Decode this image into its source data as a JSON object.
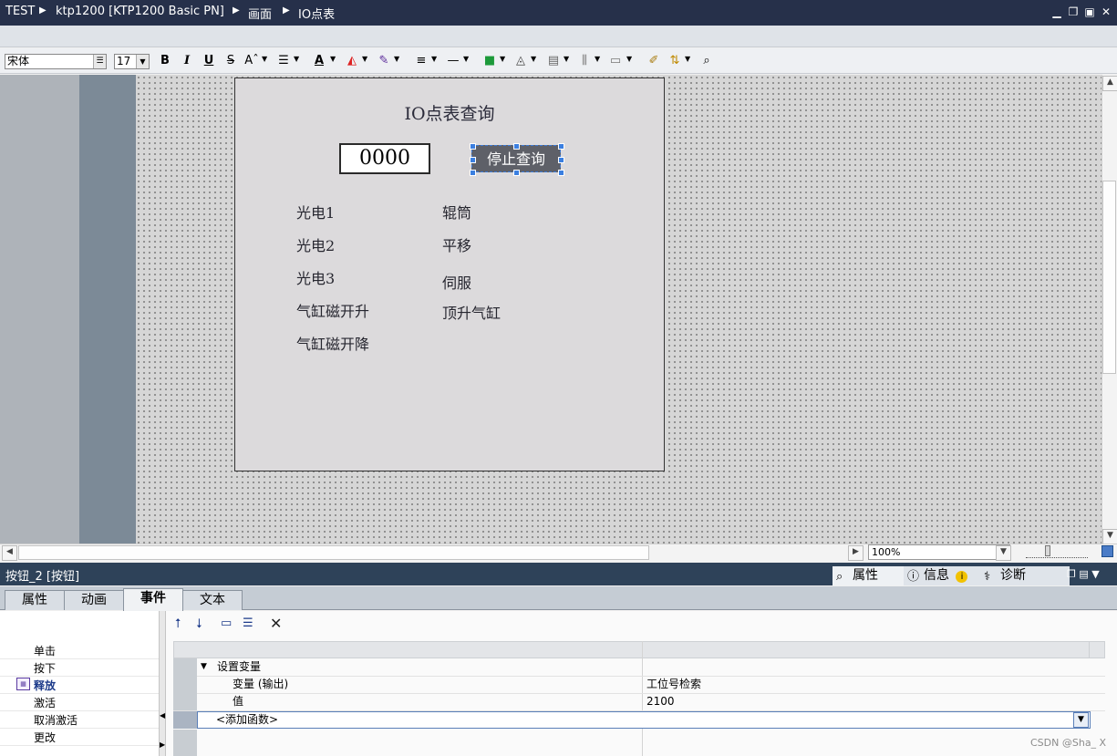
{
  "titlebar": {
    "crumbs": [
      "TEST",
      "ktp1200 [KTP1200 Basic PN]",
      "画面",
      "IO点表"
    ]
  },
  "format_toolbar": {
    "font_name": "宋体",
    "font_size": "17",
    "bold_label": "B",
    "italic_label": "I",
    "underline_label": "U",
    "strike_label": "S"
  },
  "hmi_screen": {
    "title": "IO点表查询",
    "io_field_value": "0000",
    "button_label": "停止查询",
    "left_labels": [
      "光电1",
      "光电2",
      "光电3",
      "气缸磁开升",
      "气缸磁开降"
    ],
    "right_labels": [
      "辊筒",
      "平移",
      "伺服",
      "顶升气缸"
    ]
  },
  "canvas_bar": {
    "zoom": "100%"
  },
  "inspector": {
    "title": "按钮_2 [按钮]",
    "right_tabs": [
      "属性",
      "信息",
      "诊断"
    ],
    "tabs": [
      "属性",
      "动画",
      "事件",
      "文本"
    ],
    "active_tab": "事件",
    "events": [
      "单击",
      "按下",
      "释放",
      "激活",
      "取消激活",
      "更改"
    ],
    "selected_event": "释放",
    "function_group": "设置变量",
    "params": [
      {
        "name": "变量 (输出)",
        "value": "工位号检索"
      },
      {
        "name": "值",
        "value": "2100"
      }
    ],
    "add_function": "<添加函数>"
  },
  "watermark": "CSDN @Sha_ X",
  "colors": {
    "titlebar": "#26304a",
    "button": "#5e6068",
    "inspector_header": "#2e4259",
    "selection": "#3b7fe0"
  }
}
